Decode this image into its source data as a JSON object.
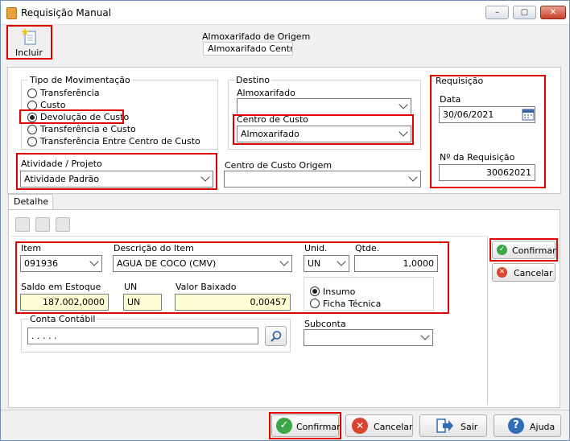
{
  "window": {
    "title": "Requisição Manual",
    "min": "–",
    "max": "▢",
    "close": "✕"
  },
  "toolbar": {
    "incluir_label": "Incluir"
  },
  "almox": {
    "label": "Almoxarifado de Origem",
    "value": "Almoxarifado Central"
  },
  "tipo": {
    "label": "Tipo de Movimentação",
    "options": [
      {
        "label": "Transferência",
        "selected": false
      },
      {
        "label": "Custo",
        "selected": false
      },
      {
        "label": "Devolução de Custo",
        "selected": true
      },
      {
        "label": "Transferência e Custo",
        "selected": false
      },
      {
        "label": "Transferência Entre Centro de Custo",
        "selected": false
      }
    ]
  },
  "destino": {
    "label": "Destino",
    "almox_label": "Almoxarifado",
    "almox_value": "",
    "cc_label": "Centro de Custo",
    "cc_value": "Almoxarifado"
  },
  "requisicao": {
    "label": "Requisição",
    "data_label": "Data",
    "data_value": "30/06/2021",
    "num_label": "Nº  da Requisição",
    "num_value": "30062021"
  },
  "atividade": {
    "label": "Atividade / Projeto",
    "value": "Atividade Padrão"
  },
  "cc_origem": {
    "label": "Centro de Custo Origem",
    "value": ""
  },
  "tabs": [
    {
      "label": "Detalhe"
    }
  ],
  "item": {
    "item_label": "Item",
    "item_value": "091936",
    "desc_label": "Descrição do Item",
    "desc_value": "AGUA DE COCO (CMV)",
    "unid_label": "Unid.",
    "unid_value": "UN",
    "qtde_label": "Qtde.",
    "qtde_value": "1,0000",
    "saldo_label": "Saldo em Estoque",
    "saldo_value": "187.002,0000",
    "un_label": "UN",
    "un_value": "UN",
    "valor_label": "Valor Baixado",
    "valor_value": "0,00457",
    "insumo_label": "Insumo",
    "ficha_label": "Ficha Técnica"
  },
  "conta": {
    "label": "Conta Contábil",
    "value": ". . . . ."
  },
  "subconta": {
    "label": "Subconta",
    "value": ""
  },
  "side_buttons": {
    "confirmar": "Confirmar",
    "cancelar": "Cancelar"
  },
  "bottom_buttons": {
    "confirmar": "Confirmar",
    "cancelar": "Cancelar",
    "sair": "Sair",
    "ajuda": "Ajuda"
  },
  "colors": {
    "highlight": "#e00000",
    "yellow_field": "#ffffd6",
    "confirm": "#3aa648",
    "cancel": "#d9432f",
    "help": "#2f6db5"
  }
}
